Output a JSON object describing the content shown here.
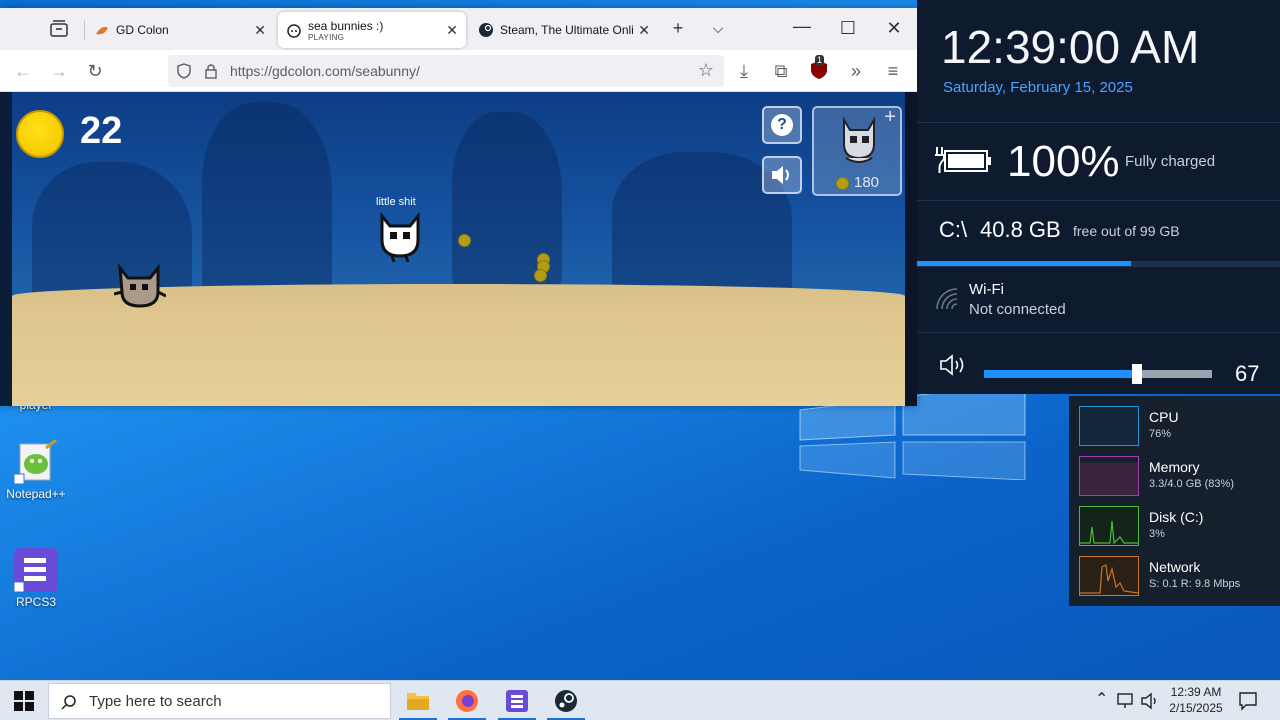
{
  "desktop": {
    "icons": [
      {
        "label": "player"
      },
      {
        "label": "Notepad++"
      },
      {
        "label": "RPCS3"
      }
    ]
  },
  "browser": {
    "tabs": [
      {
        "title": "GD Colon",
        "subtitle": ""
      },
      {
        "title": "sea bunnies :)",
        "subtitle": "PLAYING"
      },
      {
        "title": "Steam, The Ultimate Onli",
        "subtitle": ""
      }
    ],
    "url": "https://gdcolon.com/seabunny/",
    "extension_badge": "1"
  },
  "game": {
    "coins": "22",
    "player_name": "little shit",
    "help_label": "?",
    "shop_price": "180"
  },
  "widgets": {
    "clock": "12:39:00 AM",
    "date": "Saturday, February 15, 2025",
    "battery": {
      "percent": "100%",
      "status": "Fully charged"
    },
    "disk": {
      "drive": "C:\\",
      "free": "40.8 GB",
      "detail": "free out of 99 GB",
      "used_fraction": 0.59
    },
    "wifi": {
      "name": "Wi-Fi",
      "status": "Not connected"
    },
    "volume": {
      "value": "67",
      "level": 0.67
    }
  },
  "performance": [
    {
      "name": "CPU",
      "value": "76%",
      "color": "#2b8fd6"
    },
    {
      "name": "Memory",
      "value": "3.3/4.0 GB (83%)",
      "color": "#a23fb3"
    },
    {
      "name": "Disk (C:)",
      "value": "3%",
      "color": "#4fb83a"
    },
    {
      "name": "Network",
      "value": "S: 0.1 R: 9.8 Mbps",
      "color": "#c8742a"
    }
  ],
  "taskbar": {
    "search_placeholder": "Type here to search",
    "time": "12:39 AM",
    "date": "2/15/2025"
  }
}
